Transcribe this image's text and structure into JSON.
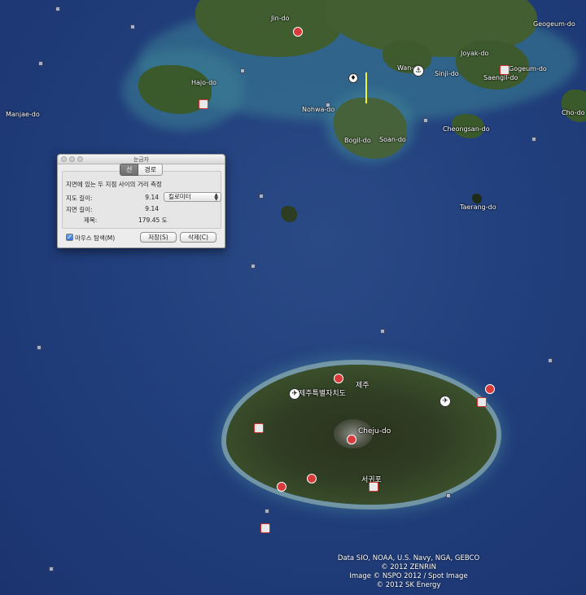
{
  "map": {
    "place_labels": [
      {
        "id": "jindo",
        "text": "Jin-do"
      },
      {
        "id": "geogeumdo",
        "text": "Geogeum-do"
      },
      {
        "id": "joyakdo",
        "text": "Joyak-do"
      },
      {
        "id": "wando",
        "text": "Wan-do"
      },
      {
        "id": "sinjido",
        "text": "Sinji-do"
      },
      {
        "id": "gogeumdo",
        "text": "Gogeum-do"
      },
      {
        "id": "saengildo",
        "text": "Saengil-do"
      },
      {
        "id": "hajodo",
        "text": "Hajo-do"
      },
      {
        "id": "manjaedo",
        "text": "Manjae-do"
      },
      {
        "id": "nohwado",
        "text": "Nohwa-do"
      },
      {
        "id": "chodo",
        "text": "Cho-do"
      },
      {
        "id": "cheongsando",
        "text": "Cheongsan-do"
      },
      {
        "id": "bogildo",
        "text": "Bogil-do"
      },
      {
        "id": "soando",
        "text": "Soan-do"
      },
      {
        "id": "taerangdo",
        "text": "Taerang-do"
      },
      {
        "id": "jeju_si",
        "text": "제주"
      },
      {
        "id": "jeju_province",
        "text": "제주특별자치도"
      },
      {
        "id": "chejudo",
        "text": "Cheju-do"
      },
      {
        "id": "seogwipo",
        "text": "서귀포"
      }
    ],
    "credits": [
      "Data SIO, NOAA, U.S. Navy, NGA, GEBCO",
      "© 2012 ZENRIN",
      "Image © NSPO 2012 / Spot Image",
      "© 2012 SK Energy"
    ],
    "measure_line_color": "#f1f23a"
  },
  "ruler": {
    "title": "눈금자",
    "tabs": [
      {
        "label": "선",
        "active": true
      },
      {
        "label": "경로",
        "active": false
      }
    ],
    "description": "지면에 있는 두 지점 사이의 거리 측정",
    "map_length_label": "지도 길이:",
    "map_length_value": "9.14",
    "ground_length_label": "지면 길이:",
    "ground_length_value": "9.14",
    "heading_label": "제목:",
    "heading_value": "179.45 도",
    "unit_select": "킬로미터",
    "mouse_nav_label": "마우스 탐색(M)",
    "mouse_nav_checked": true,
    "save_button": "저장(S)",
    "clear_button": "삭제(C)"
  }
}
